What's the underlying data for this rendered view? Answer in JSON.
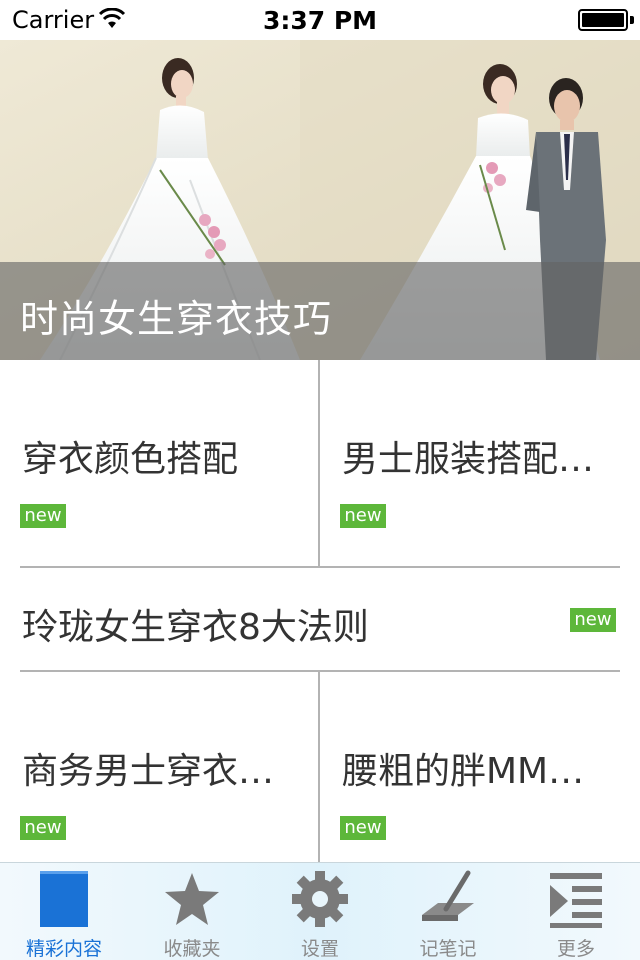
{
  "status_bar": {
    "carrier": "Carrier",
    "time": "3:37 PM"
  },
  "hero": {
    "title": "时尚女生穿衣技巧"
  },
  "articles": [
    {
      "title": "穿衣颜色搭配",
      "badge": "new"
    },
    {
      "title": "男士服装搭配…",
      "badge": "new"
    },
    {
      "title": "玲珑女生穿衣8大法则",
      "badge": "new"
    },
    {
      "title": "商务男士穿衣…",
      "badge": "new"
    },
    {
      "title": "腰粗的胖MM…",
      "badge": "new"
    }
  ],
  "tab_bar": {
    "items": [
      {
        "label": "精彩内容",
        "icon": "page-icon",
        "active": true
      },
      {
        "label": "收藏夹",
        "icon": "star-icon",
        "active": false
      },
      {
        "label": "设置",
        "icon": "gear-icon",
        "active": false
      },
      {
        "label": "记笔记",
        "icon": "pen-icon",
        "active": false
      },
      {
        "label": "更多",
        "icon": "more-list-icon",
        "active": false
      }
    ]
  },
  "colors": {
    "badge_green": "#5db73a",
    "tab_active": "#1a72d6",
    "tab_inactive": "#8a8a8a",
    "divider": "#b3b3b3"
  }
}
